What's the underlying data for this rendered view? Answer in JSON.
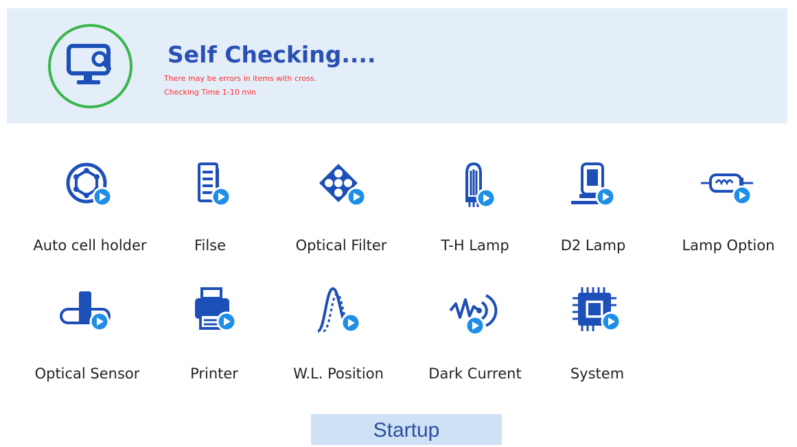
{
  "header": {
    "title": "Self Checking....",
    "line1": "There may be errors in items with cross.",
    "line2": "Checking Time 1-10 min",
    "status_icon": "monitor-search-icon",
    "ring_color": "#39b54a",
    "warning_color": "#ff2b2b"
  },
  "items": [
    {
      "label": "Auto cell holder",
      "icon": "auto-cell-holder-icon"
    },
    {
      "label": "Filse",
      "icon": "files-icon"
    },
    {
      "label": "Optical Filter",
      "icon": "optical-filter-icon"
    },
    {
      "label": "T-H Lamp",
      "icon": "th-lamp-icon"
    },
    {
      "label": "D2 Lamp",
      "icon": "d2-lamp-icon"
    },
    {
      "label": "Lamp Option",
      "icon": "lamp-option-icon"
    },
    {
      "label": "Optical Sensor",
      "icon": "optical-sensor-icon"
    },
    {
      "label": "Printer",
      "icon": "printer-icon"
    },
    {
      "label": "W.L. Position",
      "icon": "wavelength-position-icon"
    },
    {
      "label": "Dark Current",
      "icon": "dark-current-icon"
    },
    {
      "label": "System",
      "icon": "system-chip-icon"
    }
  ],
  "play_badge_icon": "play-badge-icon",
  "startup_label": "Startup",
  "colors": {
    "icon_blue": "#1d4fb8",
    "badge_blue": "#1e8ee6",
    "header_bg": "#e3eef9",
    "button_bg": "#cfe1f5"
  }
}
